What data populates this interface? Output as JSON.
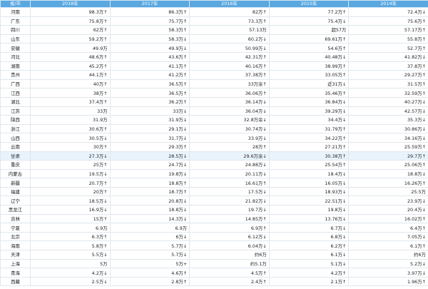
{
  "headers": [
    "省/市",
    "2018年",
    "2017年",
    "2016年",
    "2015年",
    "2014年"
  ],
  "rows": [
    [
      "河南",
      "98.3万↑",
      "86.3万↑",
      "82万↑",
      "77.2万↑",
      "72.4万↓"
    ],
    [
      "广东",
      "75.8万↑",
      "75.7万↑",
      "73.3万↑",
      "75.4万↓",
      "75.6万↑"
    ],
    [
      "四川",
      "62万↑",
      "58.3万↑",
      "57.13万",
      "超57万",
      "57.17万↑"
    ],
    [
      "山东",
      "59.2万↑",
      "58.3万↓",
      "60.2万↓",
      "69.61万↑",
      "55.8万↑"
    ],
    [
      "安徽",
      "49.9万",
      "49.9万↓",
      "50.99万↓",
      "54.6万↑",
      "52.7万↑"
    ],
    [
      "河北",
      "48.6万↑",
      "43.6万↑",
      "42.31万↑",
      "40.48万↓",
      "41.82万↓"
    ],
    [
      "湖南",
      "45.2万↑",
      "41.1万↑",
      "40.16万↑",
      "38.99万↑",
      "37.8万↑"
    ],
    [
      "贵州",
      "44.1万↑",
      "41.2万↑",
      "37.38万↑",
      "33.05万↑",
      "29.27万↑"
    ],
    [
      "广西",
      "40万↑",
      "36.5万↑",
      "33万余↑",
      "近31万↓",
      "31.5万↑"
    ],
    [
      "江西",
      "38万↑",
      "36.5万↑",
      "36.06万↑",
      "35.46万↑",
      "32.59万↑"
    ],
    [
      "湖北",
      "37.4万↑",
      "36.2万↑",
      "36.14万↓",
      "36.84万↓",
      "40.27万↓"
    ],
    [
      "江苏",
      "33万",
      "33万↓",
      "36.04万↓",
      "39.29万↓",
      "42.57万↓"
    ],
    [
      "陕西",
      "31.9万",
      "31.9万↓",
      "32.8万余↓",
      "34.4万↓",
      "35.3万↓"
    ],
    [
      "浙江",
      "30.6万↑",
      "29.1万↓",
      "30.74万↓",
      "31.79万↑",
      "30.86万↓"
    ],
    [
      "山西",
      "30.5万↓",
      "31.7万↓",
      "33.9万↓",
      "34.22万↑",
      "34.16万↓"
    ],
    [
      "云南",
      "30万↑",
      "29.3万↑",
      "28万↑",
      "27.21万↑",
      "25.59万↑"
    ],
    [
      "甘肃",
      "27.3万↓",
      "28.5万↓",
      "29.6万余↓",
      "30.38万↑",
      "29.7万↑"
    ],
    [
      "重庆",
      "25万↑",
      "24.7万↓",
      "24.88万↓",
      "25.54万↑",
      "25.06万↑"
    ],
    [
      "内蒙古",
      "19.5万↓",
      "19.8万↓",
      "20.11万↓",
      "18.4万↓",
      "18.8万↓"
    ],
    [
      "新疆",
      "20.7万↑",
      "18.8万↑",
      "16.61万↑",
      "16.05万↓",
      "16.26万↑"
    ],
    [
      "福建",
      "20万↑",
      "18.7万↑",
      "17.5万↓",
      "18.93万↓",
      "25.5万"
    ],
    [
      "辽宁",
      "18.5万↓",
      "20.8万↓",
      "21.82万↓",
      "22.51万↓",
      "23.9万↓"
    ],
    [
      "黑龙江",
      "16.9万↓",
      "18.8万↓",
      "19.7万↓",
      "19.8万↓",
      "20.4万↓"
    ],
    [
      "吉林",
      "15万↑",
      "14.3万↓",
      "14.85万↑",
      "13.76万↓",
      "16.02万↑"
    ],
    [
      "宁夏",
      "6.9万",
      "6.9万",
      "6.9万↑",
      "6.7万↓",
      "6.4万↑"
    ],
    [
      "北京",
      "6.3万↑",
      "6万↓",
      "6.12万↓",
      "6.8万↓",
      "7.05万↓"
    ],
    [
      "海南",
      "5.8万↑",
      "5.7万↓",
      "6.04万↓",
      "6.2万↑",
      "6.1万↑"
    ],
    [
      "天津",
      "5.5万↓",
      "5.7万↓",
      "约6万",
      "6.1万↓",
      "约6万"
    ],
    [
      "上海",
      "5万",
      "5万+",
      "约5.1万",
      "5.1万↓",
      "5.2万↓"
    ],
    [
      "青海",
      "4.2万↓",
      "4.6万↑",
      "4.5万↑",
      "4.2万↑",
      "3.97万↓"
    ],
    [
      "西藏",
      "2.5万↓",
      "2.8万↑",
      "2.4万↑",
      "2.1万↑",
      "1.96万↑"
    ]
  ]
}
